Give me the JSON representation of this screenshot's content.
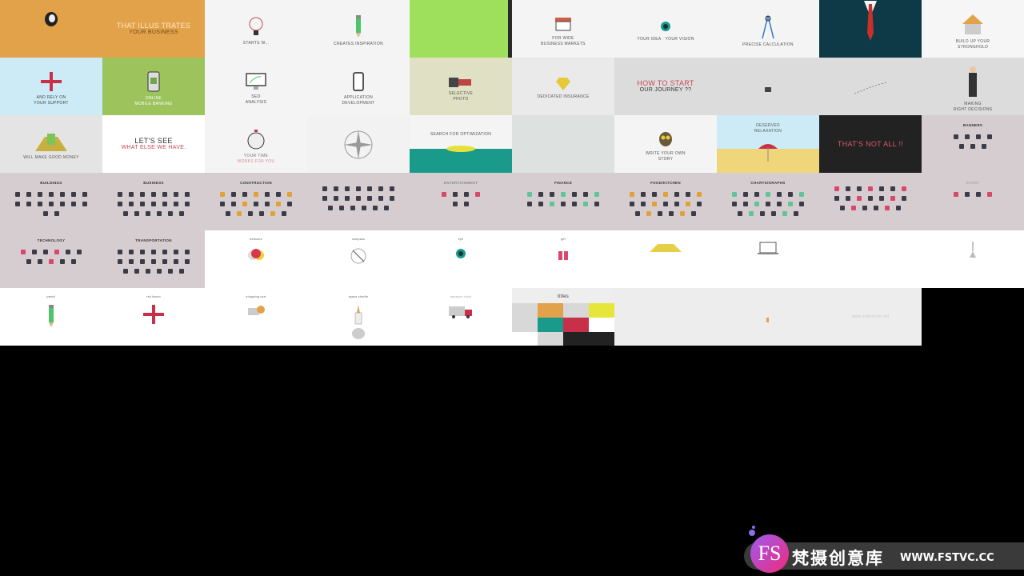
{
  "tiles": [
    {
      "bg": "#e2a24a",
      "kind": "obj",
      "icon": "logo-icon",
      "lines": []
    },
    {
      "bg": "#e2a24a",
      "kind": "head",
      "lines": [
        {
          "t": "THAT ILLUS TRATES",
          "c": "#fbe8c8"
        },
        {
          "t": "YOUR BUSINESS",
          "c": "#6b4a1c"
        }
      ]
    },
    {
      "bg": "#f4f4f4",
      "kind": "plain",
      "icon": "lightbulb-icon",
      "lines": [
        {
          "t": "STARTS W...",
          "c": "#555"
        }
      ]
    },
    {
      "bg": "#f4f4f4",
      "kind": "plain",
      "icon": "pencil-icon",
      "lines": [
        {
          "t": "CREATES    INSPIRATION",
          "c": "#555"
        }
      ]
    },
    {
      "bg": "#9ee05c",
      "kind": "plain",
      "border": "#2a2a2a",
      "lines": []
    },
    {
      "bg": "#f4f4f4",
      "kind": "plain",
      "icon": "shop-icon",
      "lines": [
        {
          "t": "FOR WIDE",
          "c": "#555"
        },
        {
          "t": "BUSINESS MARKETS",
          "c": "#555"
        }
      ]
    },
    {
      "bg": "#f4f4f4",
      "kind": "plain",
      "icon": "eye-icon",
      "lines": [
        {
          "t": "YOUR IDEA  ·  YOUR VISION",
          "c": "#555"
        }
      ]
    },
    {
      "bg": "#f4f4f4",
      "kind": "plain",
      "icon": "compass-tool-icon",
      "lines": [
        {
          "t": "PRECISE    CALCULATION",
          "c": "#555"
        }
      ]
    },
    {
      "bg": "#0d3a46",
      "kind": "plain",
      "icon": "suit-tie-icon",
      "lines": []
    },
    {
      "bg": "#f6f6f6",
      "kind": "plain",
      "icon": "house-icon",
      "lines": [
        {
          "t": "BUILD UP YOUR",
          "c": "#555"
        },
        {
          "t": "STRONGHOLD",
          "c": "#555"
        }
      ]
    },
    {
      "bg": "#cdebf7",
      "kind": "plain",
      "icon": "plane-icon",
      "lines": [
        {
          "t": "AND RELY ON",
          "c": "#444"
        },
        {
          "t": "YOUR SUPPORT",
          "c": "#444"
        }
      ]
    },
    {
      "bg": "#9cc35c",
      "kind": "plain",
      "icon": "phone-bank-icon",
      "lines": [
        {
          "t": "ONLINE",
          "c": "#fff"
        },
        {
          "t": "MOBILE BANKING",
          "c": "#fff"
        }
      ]
    },
    {
      "bg": "#f4f4f4",
      "kind": "plain",
      "icon": "monitor-chart-icon",
      "lines": [
        {
          "t": "SEO",
          "c": "#555"
        },
        {
          "t": "ANALYSIS",
          "c": "#555"
        }
      ]
    },
    {
      "bg": "#f4f4f4",
      "kind": "plain",
      "icon": "smartphone-icon",
      "lines": [
        {
          "t": "APPLICATION",
          "c": "#555"
        },
        {
          "t": "DEVELOPMENT",
          "c": "#555"
        }
      ]
    },
    {
      "bg": "#e0e0c4",
      "kind": "plain",
      "icon": "camera-icon",
      "lines": [
        {
          "t": "SELECTIVE",
          "c": "#555"
        },
        {
          "t": "PHOTO",
          "c": "#555"
        }
      ]
    },
    {
      "bg": "#eaeaea",
      "kind": "plain",
      "icon": "diamond-icon",
      "lines": [
        {
          "t": "DEDICATED   INSURANCE",
          "c": "#555"
        }
      ]
    },
    {
      "bg": "#dcdcdc",
      "kind": "head",
      "lines": [
        {
          "t": "HOW TO START",
          "c": "#c64a55"
        },
        {
          "t": "OUR JOURNEY ??",
          "c": "#333"
        }
      ]
    },
    {
      "bg": "#dcdcdc",
      "kind": "plain",
      "icon": "castle-icon",
      "lines": []
    },
    {
      "bg": "#dcdcdc",
      "kind": "plain",
      "icon": "path-icon",
      "lines": []
    },
    {
      "bg": "#dcdcdc",
      "kind": "plain",
      "icon": "businessman-icon",
      "lines": [
        {
          "t": "MAKING",
          "c": "#555"
        },
        {
          "t": "RIGHT DECISIONS",
          "c": "#555"
        }
      ]
    },
    {
      "bg": "#e4e4e4",
      "kind": "plain",
      "icon": "money-bags-icon",
      "lines": [
        {
          "t": "WILL MAKE    GOOD MONEY",
          "c": "#555"
        }
      ]
    },
    {
      "bg": "#ffffff",
      "kind": "head",
      "lines": [
        {
          "t": "LET'S SEE",
          "c": "#333"
        },
        {
          "t": "WHAT ELSE WE HAVE.",
          "c": "#c64a55"
        }
      ]
    },
    {
      "bg": "#f4f4f4",
      "kind": "plain",
      "icon": "stopwatch-icon",
      "lines": [
        {
          "t": "YOUR TIME",
          "c": "#777"
        },
        {
          "t": "WORKS FOR YOU",
          "c": "#d98a9a"
        }
      ]
    },
    {
      "bg": "#f2f2f2",
      "kind": "plain",
      "icon": "compass-rose-icon",
      "lines": []
    },
    {
      "bg": "#f4f4f4",
      "kind": "split",
      "bottom": "#1a9a8a",
      "icon": "submarine-icon",
      "lines": [
        {
          "t": "SEARCH FOR OPTIMIZATION",
          "c": "#555"
        }
      ]
    },
    {
      "bg": "#dde2e0",
      "kind": "plain",
      "lines": []
    },
    {
      "bg": "#f4f4f4",
      "kind": "plain",
      "icon": "owl-icon",
      "lines": [
        {
          "t": "WRITE YOUR OWN",
          "c": "#555"
        },
        {
          "t": "STORY",
          "c": "#555"
        }
      ]
    },
    {
      "bg": "#cdebf7",
      "kind": "split",
      "bottom": "#f0d67a",
      "icon": "beach-umbrella-icon",
      "lines": [
        {
          "t": "DESERVED",
          "c": "#555"
        },
        {
          "t": "RELAXATION",
          "c": "#555"
        }
      ]
    },
    {
      "bg": "#222222",
      "kind": "head",
      "lines": [
        {
          "t": "THAT'S NOT ALL !!",
          "c": "#d9596a"
        }
      ]
    },
    {
      "bg": "#d6cdd1",
      "kind": "label",
      "icon_rows": [
        4,
        3
      ],
      "lines": [
        {
          "t": "BANNERS",
          "c": "#333"
        }
      ]
    },
    {
      "bg": "#d6cdd1",
      "kind": "label",
      "icon_rows": [
        7,
        7,
        2
      ],
      "lines": [
        {
          "t": "BUILDINGS",
          "c": "#333"
        }
      ]
    },
    {
      "bg": "#d6cdd1",
      "kind": "label",
      "icon_rows": [
        7,
        7,
        6
      ],
      "lines": [
        {
          "t": "BUSINESS",
          "c": "#333"
        }
      ]
    },
    {
      "bg": "#d6cdd1",
      "kind": "label",
      "icon_rows": [
        7,
        7,
        6
      ],
      "accent": "a",
      "lines": [
        {
          "t": "CONSTRUCTION",
          "c": "#333"
        }
      ]
    },
    {
      "bg": "#d6cdd1",
      "kind": "label",
      "icon_rows": [
        7,
        7,
        6
      ],
      "lines": [
        {
          "t": "",
          "c": "#333"
        }
      ]
    },
    {
      "bg": "#d6cdd1",
      "kind": "label",
      "icon_rows": [
        4,
        2
      ],
      "accent": "p",
      "lines": [
        {
          "t": "ENTERTAINMENT",
          "c": "#888"
        }
      ]
    },
    {
      "bg": "#d6cdd1",
      "kind": "label",
      "icon_rows": [
        7,
        7
      ],
      "accent": "g",
      "lines": [
        {
          "t": "FINANCE",
          "c": "#333"
        }
      ]
    },
    {
      "bg": "#d6cdd1",
      "kind": "label",
      "icon_rows": [
        7,
        7,
        6
      ],
      "accent": "a",
      "lines": [
        {
          "t": "FOOD/KITCHEN",
          "c": "#333"
        }
      ]
    },
    {
      "bg": "#d6cdd1",
      "kind": "label",
      "icon_rows": [
        7,
        7,
        6
      ],
      "accent": "g",
      "lines": [
        {
          "t": "CHARTS/GRAPHS",
          "c": "#333"
        }
      ]
    },
    {
      "bg": "#d6cdd1",
      "kind": "label",
      "icon_rows": [
        7,
        7,
        6
      ],
      "accent": "p",
      "lines": [
        {
          "t": "",
          "c": "#333"
        }
      ]
    },
    {
      "bg": "#d6cdd1",
      "kind": "label",
      "icon_rows": [
        4
      ],
      "accent": "p",
      "lines": [
        {
          "t": "SPORT",
          "c": "#aaa"
        }
      ]
    },
    {
      "bg": "#d6cdd1",
      "kind": "label",
      "icon_rows": [
        6,
        5
      ],
      "accent": "p",
      "lines": [
        {
          "t": "TECHNOLOGY",
          "c": "#333"
        }
      ]
    },
    {
      "bg": "#d6cdd1",
      "kind": "label",
      "icon_rows": [
        7,
        7,
        6
      ],
      "lines": [
        {
          "t": "TRANSPORTATION",
          "c": "#333"
        }
      ]
    },
    {
      "bg": "#ffffff",
      "kind": "obj",
      "icon": "balloons-icon",
      "lines": [
        {
          "t": "balloons",
          "c": "#555"
        }
      ]
    },
    {
      "bg": "#ffffff",
      "kind": "obj",
      "icon": "compass-icon",
      "lines": [
        {
          "t": "compass",
          "c": "#555"
        }
      ]
    },
    {
      "bg": "#ffffff",
      "kind": "obj",
      "icon": "eye-icon",
      "lines": [
        {
          "t": "eye",
          "c": "#555"
        }
      ]
    },
    {
      "bg": "#ffffff",
      "kind": "obj",
      "icon": "gift-icon",
      "lines": [
        {
          "t": "gift",
          "c": "#555"
        }
      ]
    },
    {
      "bg": "#ffffff",
      "kind": "obj",
      "icon": "gold-coins-icon",
      "lines": []
    },
    {
      "bg": "#ffffff",
      "kind": "obj",
      "icon": "laptop-icon",
      "lines": []
    },
    {
      "bg": "#ffffff",
      "kind": "obj",
      "lines": []
    },
    {
      "bg": "#ffffff",
      "kind": "obj",
      "icon": "lamp-icon",
      "lines": []
    },
    {
      "bg": "#ffffff",
      "kind": "obj",
      "icon": "pencil-icon",
      "lines": [
        {
          "t": "pencil",
          "c": "#555"
        }
      ]
    },
    {
      "bg": "#ffffff",
      "kind": "obj",
      "icon": "plane-icon",
      "lines": [
        {
          "t": "red baron",
          "c": "#555"
        }
      ]
    },
    {
      "bg": "#ffffff",
      "kind": "obj",
      "icon": "shopping-cart-icon",
      "lines": [
        {
          "t": "shopping cart",
          "c": "#555"
        }
      ]
    },
    {
      "bg": "#ffffff",
      "kind": "obj",
      "icon": "space-shuttle-icon",
      "lines": [
        {
          "t": "space shuttle",
          "c": "#555"
        }
      ]
    },
    {
      "bg": "#ffffff",
      "kind": "obj",
      "icon": "truck-icon",
      "lines": [
        {
          "t": "transport truck",
          "c": "#999"
        }
      ]
    },
    {
      "bg": "#eeeeee",
      "kind": "titles",
      "lines": [
        {
          "t": "titles",
          "c": "#333"
        }
      ]
    },
    {
      "bg": "#ededed",
      "kind": "plain",
      "lines": []
    },
    {
      "bg": "#ededed",
      "kind": "plain",
      "icon": "dot-icon",
      "lines": []
    },
    {
      "bg": "#ededed",
      "kind": "plain",
      "lines": [
        {
          "t": "www.videohive.net",
          "c": "#c8c8c8"
        }
      ]
    },
    {
      "bg": "#000000",
      "kind": "plain",
      "lines": []
    }
  ],
  "titles_swatches": [
    "#d8d8d8",
    "#e2a24a",
    "#d8d8d8",
    "#e6e63a",
    "#d8d8d8",
    "#1a9a8a",
    "#c8304a",
    "#ffffff",
    "#ffffff",
    "#d8d8d8",
    "#222222",
    "#222222"
  ],
  "watermark": {
    "logo": "FS",
    "name": "梵摄创意库",
    "url": "WWW.FSTVC.CC"
  }
}
